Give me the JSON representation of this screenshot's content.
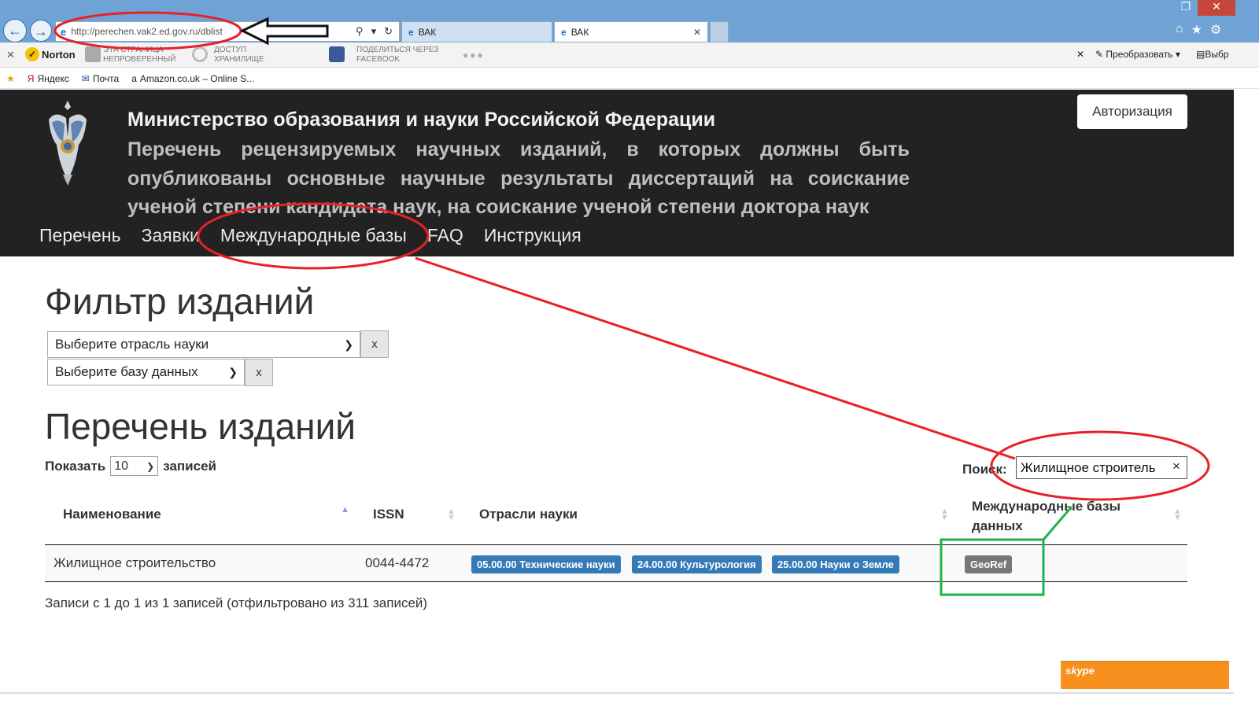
{
  "browser": {
    "url": "http://perechen.vak2.ed.gov.ru/dblist",
    "tabs": [
      {
        "label": "ВАК"
      },
      {
        "label": "ВАК"
      }
    ],
    "toolbar": {
      "norton": "Norton",
      "page_status_line1": "ЭТА СТРАНИЦА",
      "page_status_line2": "НЕПРОВЕРЕННЫЙ",
      "storage_line1": "ДОСТУП",
      "storage_line2": "ХРАНИЛИЩЕ",
      "share_line1": "ПОДЕЛИТЬСЯ ЧЕРЕЗ",
      "share_line2": "FACEBOOK",
      "convert": "Преобразовать",
      "select": "Выбр"
    },
    "favorites": [
      "Яндекс",
      "Почта",
      "Amazon.co.uk – Online S..."
    ]
  },
  "site": {
    "title": "Министерство образования и науки Российской Федерации",
    "subtitle": "Перечень рецензируемых научных изданий, в которых должны быть опубликованы основные научные результаты диссертаций на соискание ученой степени кандидата наук, на соискание ученой степени доктора наук",
    "auth_button": "Авторизация",
    "nav": [
      "Перечень",
      "Заявки",
      "Международные базы",
      "FAQ",
      "Инструкция"
    ]
  },
  "filter": {
    "heading": "Фильтр изданий",
    "science_select": "Выберите отрасль науки",
    "db_select": "Выберите базу данных",
    "clear_label": "x"
  },
  "list": {
    "heading": "Перечень изданий",
    "show_label": "Показать",
    "page_size": "10",
    "entries_label": "записей",
    "search_label": "Поиск:",
    "search_value": "Жилищное строитель",
    "search_clear": "×",
    "columns": [
      "Наименование",
      "ISSN",
      "Отрасли науки",
      "Международные базы данных"
    ],
    "rows": [
      {
        "name": "Жилищное строительство",
        "issn": "0044-4472",
        "sciences": [
          "05.00.00 Технические науки",
          "24.00.00 Культурология",
          "25.00.00 Науки о Земле"
        ],
        "databases": [
          "GeoRef"
        ]
      }
    ],
    "info": "Записи с 1 до 1 из 1 записей (отфильтровано из 311 записей)"
  },
  "skype": "skype",
  "colors": {
    "header_bg": "#222222",
    "label_blue": "#337ab7",
    "label_gray": "#777777",
    "annotation_red": "#e8202a",
    "annotation_green": "#22b14c"
  }
}
